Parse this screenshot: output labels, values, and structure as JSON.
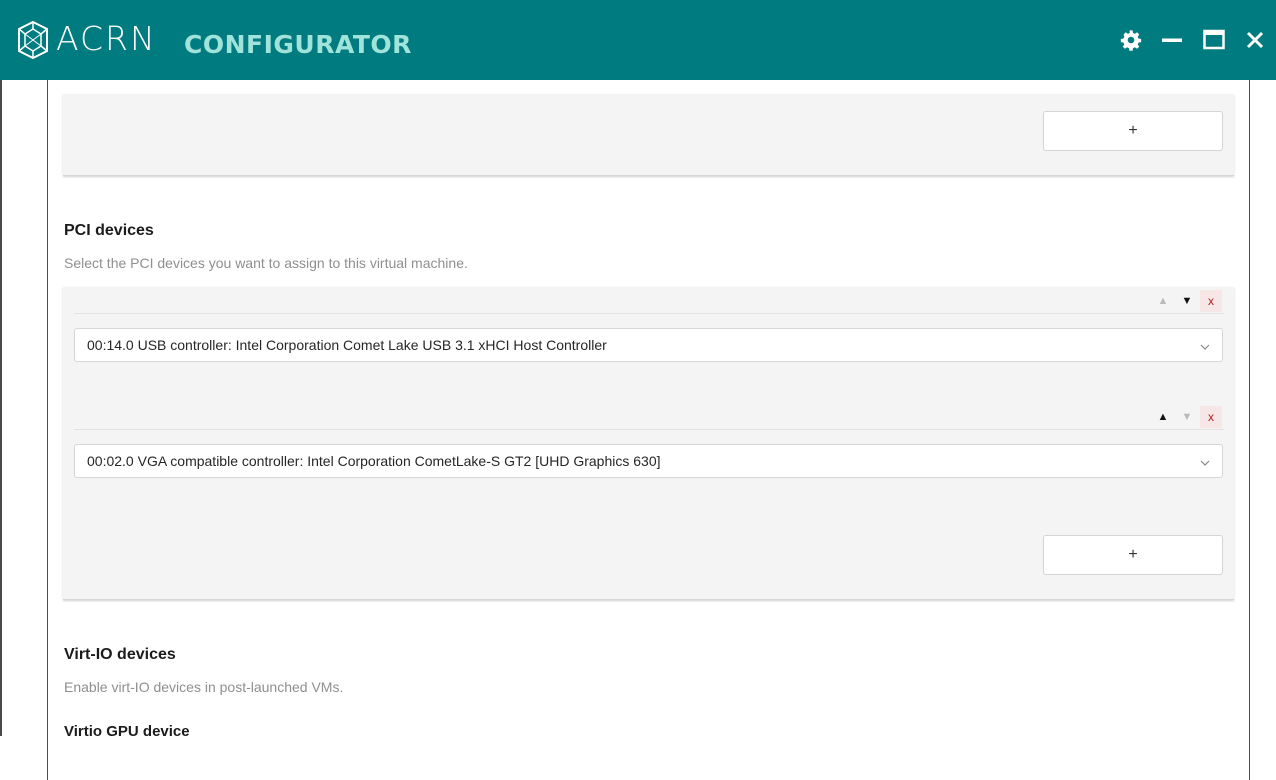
{
  "app": {
    "brand": "ACRN",
    "product": "CONFIGURATOR"
  },
  "window_controls": {
    "settings_icon": "gear-icon",
    "minimize_icon": "minimize-icon",
    "maximize_icon": "maximize-icon",
    "close_icon": "close-icon"
  },
  "top_panel": {
    "add_label": "+"
  },
  "pci_section": {
    "title": "PCI devices",
    "description": "Select the PCI devices you want to assign to this virtual machine.",
    "devices": [
      {
        "value": "00:14.0 USB controller: Intel Corporation Comet Lake USB 3.1 xHCI Host Controller",
        "up_enabled": false,
        "down_enabled": true,
        "remove_label": "x"
      },
      {
        "value": "00:02.0 VGA compatible controller: Intel Corporation CometLake-S GT2 [UHD Graphics 630]",
        "up_enabled": true,
        "down_enabled": false,
        "remove_label": "x"
      }
    ],
    "add_label": "+"
  },
  "virtio_section": {
    "title": "Virt-IO devices",
    "description": "Enable virt-IO devices in post-launched VMs.",
    "gpu_title": "Virtio GPU device"
  },
  "colors": {
    "titlebar": "#007b80",
    "product_text": "#9fe3da",
    "frame_border": "#7a2c84",
    "panel_bg": "#f4f4f4"
  }
}
